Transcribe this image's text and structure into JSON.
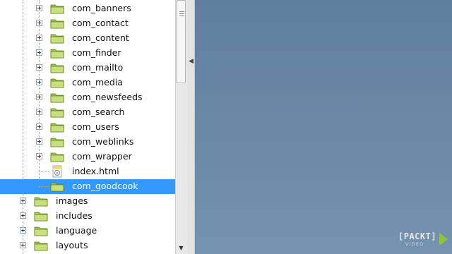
{
  "tree": {
    "items": [
      {
        "label": "com_banners",
        "type": "folder",
        "expandable": true
      },
      {
        "label": "com_contact",
        "type": "folder",
        "expandable": true
      },
      {
        "label": "com_content",
        "type": "folder",
        "expandable": true
      },
      {
        "label": "com_finder",
        "type": "folder",
        "expandable": true
      },
      {
        "label": "com_mailto",
        "type": "folder",
        "expandable": true
      },
      {
        "label": "com_media",
        "type": "folder",
        "expandable": true
      },
      {
        "label": "com_newsfeeds",
        "type": "folder",
        "expandable": true
      },
      {
        "label": "com_search",
        "type": "folder",
        "expandable": true
      },
      {
        "label": "com_users",
        "type": "folder",
        "expandable": true
      },
      {
        "label": "com_weblinks",
        "type": "folder",
        "expandable": true
      },
      {
        "label": "com_wrapper",
        "type": "folder",
        "expandable": true
      },
      {
        "label": "index.html",
        "type": "file",
        "expandable": false
      },
      {
        "label": "com_goodcook",
        "type": "folder",
        "expandable": false,
        "selected": true
      },
      {
        "label": "images",
        "type": "folder",
        "expandable": true
      },
      {
        "label": "includes",
        "type": "folder",
        "expandable": true
      },
      {
        "label": "language",
        "type": "folder",
        "expandable": true
      },
      {
        "label": "layouts",
        "type": "folder",
        "expandable": true
      }
    ]
  },
  "logo": {
    "text": "[PACKT]",
    "subtext": "VIDEO"
  },
  "colors": {
    "selection": "#3399ff",
    "folder_fill": "#b8d86a",
    "workspace": "#6b89a7"
  },
  "icons": {
    "folder": "folder-icon",
    "file": "html-file-icon",
    "expander": "plus-expander-icon",
    "scroll_down": "scroll-down-arrow-icon",
    "collapse": "collapse-left-arrow-icon"
  }
}
